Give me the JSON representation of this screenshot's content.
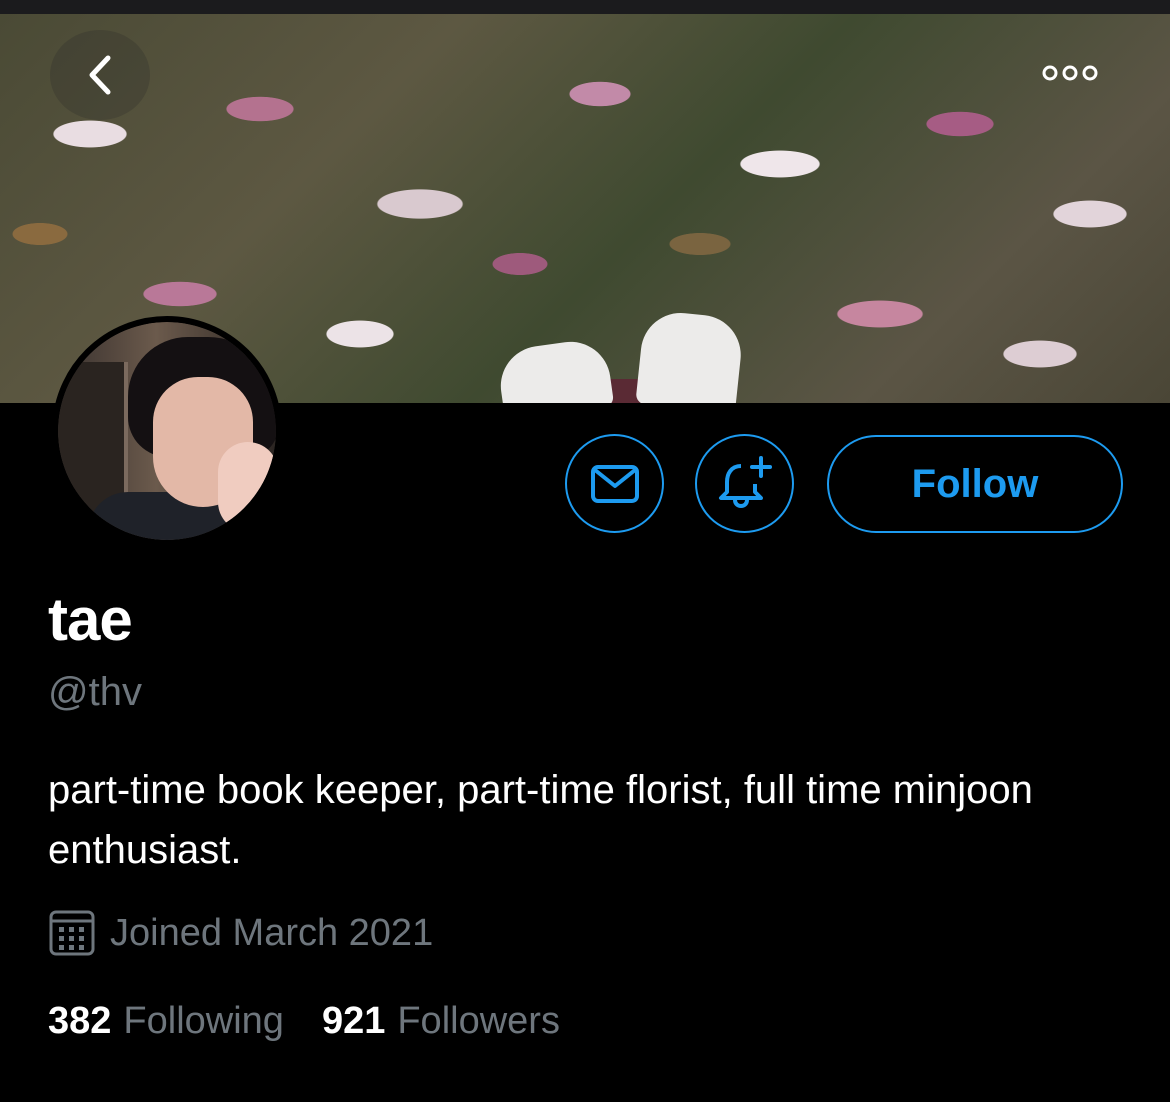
{
  "header": {
    "back_icon": "chevron-left-icon",
    "more_icon": "more-horizontal-icon"
  },
  "actions": {
    "message_icon": "mail-icon",
    "notify_icon": "bell-plus-icon",
    "follow_label": "Follow"
  },
  "profile": {
    "display_name": "tae",
    "handle": "@thv",
    "bio": "part-time book keeper, part-time florist, full time minjoon enthusiast.",
    "joined": "Joined March 2021",
    "following_count": "382",
    "following_label": "Following",
    "followers_count": "921",
    "followers_label": "Followers"
  },
  "colors": {
    "background": "#000000",
    "accent": "#1d9bf0",
    "secondary_text": "#6e767d",
    "primary_text": "#ffffff"
  }
}
